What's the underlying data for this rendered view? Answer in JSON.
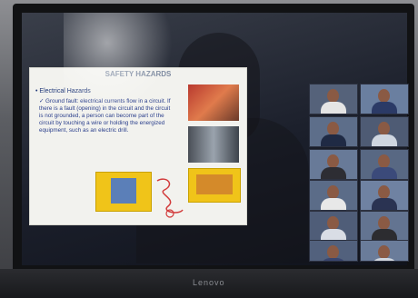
{
  "slide": {
    "title": "SAFETY HAZARDS",
    "bullet": "• Electrical Hazards",
    "text": "✓ Ground fault: electrical currents flow in a circuit. If there is a fault (opening) in the circuit and the circuit is not grounded, a person can become part of the circuit by touching a wire or holding the energized equipment, such as an electric drill."
  },
  "monitor": {
    "brand": "Lenovo"
  },
  "participants": [
    {
      "shirt": "#e5e5e5",
      "bg": "#55627a"
    },
    {
      "shirt": "#2b3a66",
      "bg": "#6a7fa0"
    },
    {
      "shirt": "#1f2a44",
      "bg": "#5d6e8a"
    },
    {
      "shirt": "#cfd6e0",
      "bg": "#4e5b74"
    },
    {
      "shirt": "#2d2d33",
      "bg": "#687a98"
    },
    {
      "shirt": "#3b4a7a",
      "bg": "#586883"
    },
    {
      "shirt": "#e8e8e8",
      "bg": "#5b6c88"
    },
    {
      "shirt": "#2a3352",
      "bg": "#6f82a2"
    },
    {
      "shirt": "#d9dde5",
      "bg": "#4f5d78"
    },
    {
      "shirt": "#2c2c30",
      "bg": "#637491"
    },
    {
      "shirt": "#39456e",
      "bg": "#52617d"
    },
    {
      "shirt": "#d0d6de",
      "bg": "#6a7c9a"
    }
  ]
}
